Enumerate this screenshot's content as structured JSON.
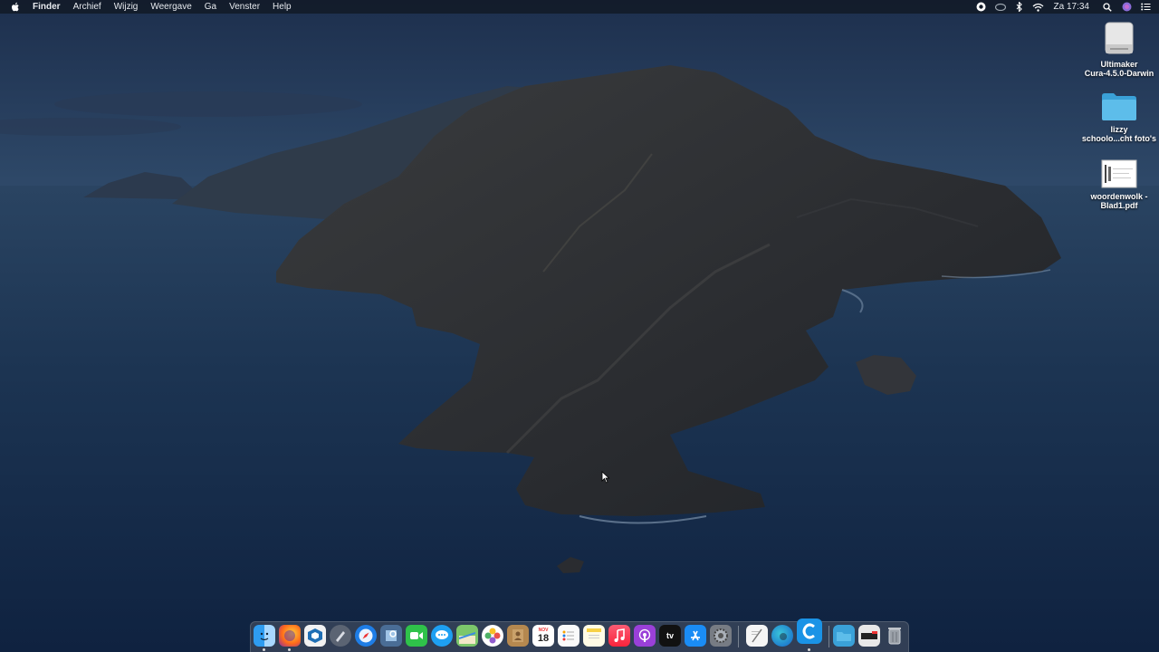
{
  "menubar": {
    "app_name": "Finder",
    "items": [
      "Archief",
      "Wijzig",
      "Weergave",
      "Ga",
      "Venster",
      "Help"
    ],
    "clock": "Za 17:34"
  },
  "desktop": {
    "items": [
      {
        "line1": "Ultimaker",
        "line2": "Cura-4.5.0-Darwin",
        "icon": "disk-image-icon"
      },
      {
        "line1": "lizzy",
        "line2": "schoolo...cht foto's",
        "icon": "folder-icon"
      },
      {
        "line1": "woordenwolk -",
        "line2": "Blad1.pdf",
        "icon": "pdf-document-icon"
      }
    ]
  },
  "dock": {
    "calendar_day": "18",
    "calendar_month": "NOV",
    "apps": [
      "finder-icon",
      "firefox-icon",
      "sketchup-icon",
      "launchpad-icon",
      "safari-icon",
      "preview-icon",
      "facetime-icon",
      "messages-icon",
      "maps-icon",
      "photos-icon",
      "contacts-icon",
      "calendar-icon",
      "reminders-icon",
      "notes-icon",
      "music-icon",
      "podcasts-icon",
      "apple-tv-icon",
      "app-store-icon",
      "system-preferences-icon",
      "textedit-icon",
      "edge-icon",
      "cura-icon",
      "downloads-folder-icon",
      "keyboard-icon",
      "trash-icon"
    ],
    "tv_label": "tv"
  },
  "colors": {
    "sky_top": "#1b3050",
    "sea": "#163050",
    "island": "#2a2d33",
    "menubar": "#121a28"
  }
}
